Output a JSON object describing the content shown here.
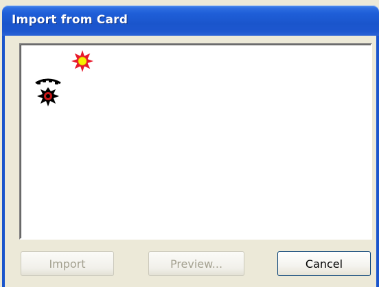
{
  "window": {
    "title": "Import from Card"
  },
  "thumbnails": [
    {
      "name": "flower-thumbnail",
      "icon": "flower-icon",
      "colors": {
        "petals": "#e8192c",
        "center": "#f7f000"
      }
    },
    {
      "name": "bomb-thumbnail",
      "icon": "bomb-icon",
      "colors": {
        "body": "#000000",
        "accent": "#c81818"
      }
    }
  ],
  "buttons": {
    "import_label": "Import",
    "preview_label": "Preview...",
    "cancel_label": "Cancel"
  },
  "states": {
    "import_enabled": false,
    "preview_enabled": false,
    "cancel_enabled": true
  }
}
